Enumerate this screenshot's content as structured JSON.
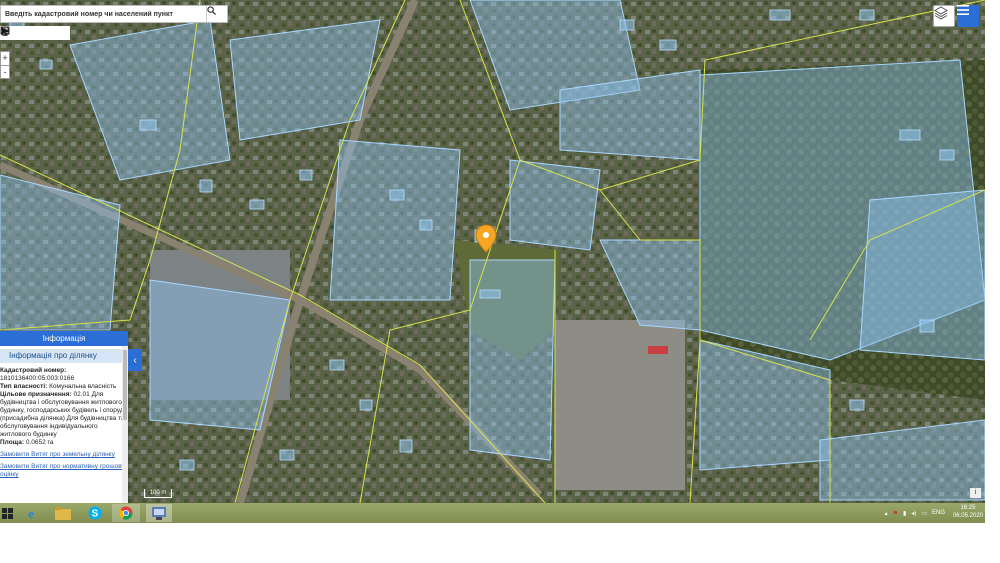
{
  "search": {
    "placeholder": "Введіть кадастровий номер чи населений пункт"
  },
  "toolbar": {
    "icons": [
      "print-icon",
      "measure-icon",
      "area-icon",
      "pointer-icon",
      "info-icon"
    ]
  },
  "zoom": {
    "in": "+",
    "out": "-"
  },
  "info_panel": {
    "title": "Інформація",
    "subtitle": "Інформація про ділянку",
    "cadastral_label": "Кадастровий номер:",
    "cadastral_value": "1810136400:05:003:0166",
    "ownership_label": "Тип власності:",
    "ownership_value": "Комунальна власність",
    "purpose_label": "Цільове призначення:",
    "purpose_value": "02.01 Для будівництва і обслуговування житлового будинку, господарських будівель і споруд (присадибна ділянка) Для будівництва та обслуговування індивідуального житлового будинку",
    "area_label": "Площа:",
    "area_value": "0.0652 га",
    "link1": "Замовити Витяг про земельну ділянку",
    "link2": "Замовити Витяг про нормативну грошову оцінку"
  },
  "scale": {
    "label": "100 m"
  },
  "attribution": {
    "label": "i"
  },
  "colors": {
    "accent": "#2b6fd6",
    "parcel_fill": "#8fc4ef",
    "parcel_border": "#9fd0ff",
    "boundary": "#d7e34a",
    "marker": "#f5a623"
  },
  "taskbar": {
    "apps": [
      "start-icon",
      "ie-icon",
      "explorer-icon",
      "skype-icon",
      "chrome-icon",
      "app-icon"
    ],
    "language": "ENG",
    "time": "16:25",
    "date": "06.05.2020"
  }
}
